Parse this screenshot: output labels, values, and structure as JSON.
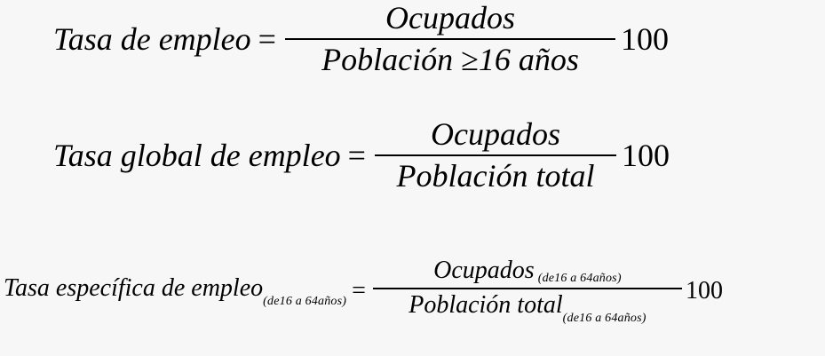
{
  "formulas": [
    {
      "lhs": "Tasa de empleo",
      "equals": "=",
      "numerator": "Ocupados",
      "denominator_main": "Población",
      "denominator_rel": "≥",
      "denominator_tail": "16 años",
      "multiplier": "100"
    },
    {
      "lhs": "Tasa global de empleo",
      "equals": "=",
      "numerator": "Ocupados",
      "denominator": "Población total",
      "multiplier": "100"
    },
    {
      "lhs": "Tasa específica de empleo",
      "lhs_sub": "(de16 a 64años)",
      "equals": "=",
      "numerator": "Ocupados",
      "numerator_sub": "(de16 a 64años)",
      "denominator": "Población total",
      "denominator_sub": "(de16 a 64años)",
      "multiplier": "100"
    }
  ]
}
